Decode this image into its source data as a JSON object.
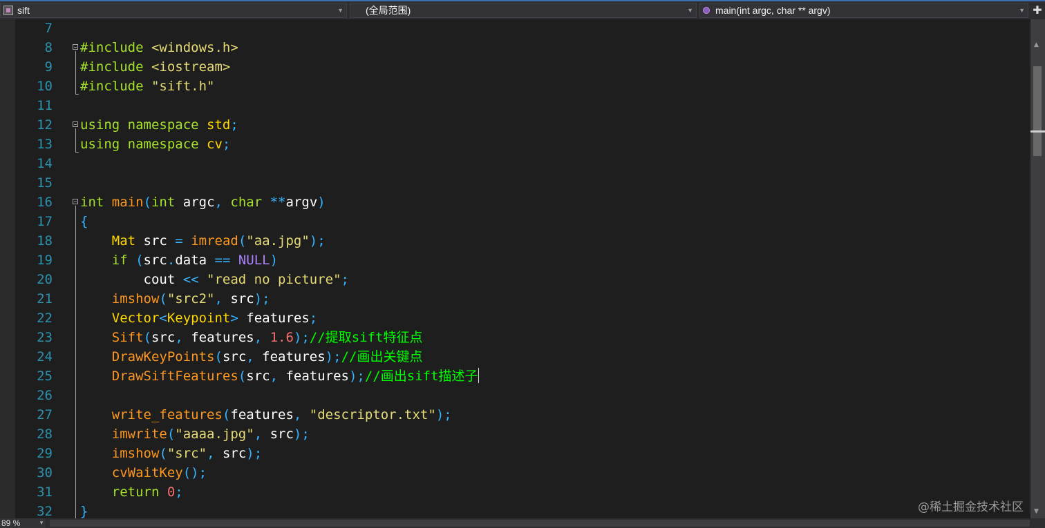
{
  "navbar": {
    "project": "sift",
    "scope": "(全局范围)",
    "member": "main(int argc, char ** argv)",
    "split_icon": "split-plus-icon"
  },
  "editor": {
    "lines": [
      {
        "num": "7",
        "tokens": []
      },
      {
        "num": "8",
        "tokens": [
          [
            "pp",
            "#include "
          ],
          [
            "str",
            "<windows.h>"
          ]
        ]
      },
      {
        "num": "9",
        "tokens": [
          [
            "pp",
            "#include "
          ],
          [
            "str",
            "<iostream>"
          ]
        ]
      },
      {
        "num": "10",
        "tokens": [
          [
            "pp",
            "#include "
          ],
          [
            "str",
            "\"sift.h\""
          ]
        ]
      },
      {
        "num": "11",
        "tokens": []
      },
      {
        "num": "12",
        "tokens": [
          [
            "kw",
            "using namespace "
          ],
          [
            "ns",
            "std"
          ],
          [
            "punc",
            ";"
          ]
        ]
      },
      {
        "num": "13",
        "tokens": [
          [
            "kw",
            "using namespace "
          ],
          [
            "ns",
            "cv"
          ],
          [
            "punc",
            ";"
          ]
        ]
      },
      {
        "num": "14",
        "tokens": []
      },
      {
        "num": "15",
        "tokens": []
      },
      {
        "num": "16",
        "tokens": [
          [
            "kw",
            "int "
          ],
          [
            "fn",
            "main"
          ],
          [
            "punc",
            "("
          ],
          [
            "kw",
            "int "
          ],
          [
            "var",
            "argc"
          ],
          [
            "punc",
            ", "
          ],
          [
            "kw",
            "char "
          ],
          [
            "punc",
            "**"
          ],
          [
            "var",
            "argv"
          ],
          [
            "punc",
            ")"
          ]
        ]
      },
      {
        "num": "17",
        "tokens": [
          [
            "punc",
            "{"
          ]
        ]
      },
      {
        "num": "18",
        "tokens": [
          [
            "plain",
            "    "
          ],
          [
            "type",
            "Mat "
          ],
          [
            "var",
            "src "
          ],
          [
            "punc",
            "= "
          ],
          [
            "fn",
            "imread"
          ],
          [
            "punc",
            "("
          ],
          [
            "str",
            "\"aa.jpg\""
          ],
          [
            "punc",
            ");"
          ]
        ]
      },
      {
        "num": "19",
        "tokens": [
          [
            "plain",
            "    "
          ],
          [
            "kw",
            "if "
          ],
          [
            "punc",
            "("
          ],
          [
            "var",
            "src"
          ],
          [
            "punc",
            "."
          ],
          [
            "var",
            "data "
          ],
          [
            "punc",
            "== "
          ],
          [
            "mac",
            "NULL"
          ],
          [
            "punc",
            ")"
          ]
        ]
      },
      {
        "num": "20",
        "tokens": [
          [
            "plain",
            "        "
          ],
          [
            "var",
            "cout "
          ],
          [
            "punc",
            "<< "
          ],
          [
            "str",
            "\"read no picture\""
          ],
          [
            "punc",
            ";"
          ]
        ]
      },
      {
        "num": "21",
        "tokens": [
          [
            "plain",
            "    "
          ],
          [
            "fn",
            "imshow"
          ],
          [
            "punc",
            "("
          ],
          [
            "str",
            "\"src2\""
          ],
          [
            "punc",
            ", "
          ],
          [
            "var",
            "src"
          ],
          [
            "punc",
            ");"
          ]
        ]
      },
      {
        "num": "22",
        "tokens": [
          [
            "plain",
            "    "
          ],
          [
            "type",
            "Vector"
          ],
          [
            "punc",
            "<"
          ],
          [
            "type",
            "Keypoint"
          ],
          [
            "punc",
            "> "
          ],
          [
            "var",
            "features"
          ],
          [
            "punc",
            ";"
          ]
        ]
      },
      {
        "num": "23",
        "tokens": [
          [
            "plain",
            "    "
          ],
          [
            "fn",
            "Sift"
          ],
          [
            "punc",
            "("
          ],
          [
            "var",
            "src"
          ],
          [
            "punc",
            ", "
          ],
          [
            "var",
            "features"
          ],
          [
            "punc",
            ", "
          ],
          [
            "num",
            "1.6"
          ],
          [
            "punc",
            ");"
          ],
          [
            "cm",
            "//提取sift特征点"
          ]
        ]
      },
      {
        "num": "24",
        "tokens": [
          [
            "plain",
            "    "
          ],
          [
            "fn",
            "DrawKeyPoints"
          ],
          [
            "punc",
            "("
          ],
          [
            "var",
            "src"
          ],
          [
            "punc",
            ", "
          ],
          [
            "var",
            "features"
          ],
          [
            "punc",
            ");"
          ],
          [
            "cm",
            "//画出关键点"
          ]
        ]
      },
      {
        "num": "25",
        "tokens": [
          [
            "plain",
            "    "
          ],
          [
            "fn",
            "DrawSiftFeatures"
          ],
          [
            "punc",
            "("
          ],
          [
            "var",
            "src"
          ],
          [
            "punc",
            ", "
          ],
          [
            "var",
            "features"
          ],
          [
            "punc",
            ");"
          ],
          [
            "cm",
            "//画出sift描述子"
          ]
        ],
        "cursor": true
      },
      {
        "num": "26",
        "tokens": []
      },
      {
        "num": "27",
        "tokens": [
          [
            "plain",
            "    "
          ],
          [
            "fn",
            "write_features"
          ],
          [
            "punc",
            "("
          ],
          [
            "var",
            "features"
          ],
          [
            "punc",
            ", "
          ],
          [
            "str",
            "\"descriptor.txt\""
          ],
          [
            "punc",
            ");"
          ]
        ]
      },
      {
        "num": "28",
        "tokens": [
          [
            "plain",
            "    "
          ],
          [
            "fn",
            "imwrite"
          ],
          [
            "punc",
            "("
          ],
          [
            "str",
            "\"aaaa.jpg\""
          ],
          [
            "punc",
            ", "
          ],
          [
            "var",
            "src"
          ],
          [
            "punc",
            ");"
          ]
        ]
      },
      {
        "num": "29",
        "tokens": [
          [
            "plain",
            "    "
          ],
          [
            "fn",
            "imshow"
          ],
          [
            "punc",
            "("
          ],
          [
            "str",
            "\"src\""
          ],
          [
            "punc",
            ", "
          ],
          [
            "var",
            "src"
          ],
          [
            "punc",
            ");"
          ]
        ]
      },
      {
        "num": "30",
        "tokens": [
          [
            "plain",
            "    "
          ],
          [
            "fn",
            "cvWaitKey"
          ],
          [
            "punc",
            "();"
          ]
        ]
      },
      {
        "num": "31",
        "tokens": [
          [
            "plain",
            "    "
          ],
          [
            "kw",
            "return "
          ],
          [
            "num",
            "0"
          ],
          [
            "punc",
            ";"
          ]
        ]
      },
      {
        "num": "32",
        "tokens": [
          [
            "punc",
            "}"
          ]
        ]
      }
    ]
  },
  "status": {
    "zoom": "89 %"
  },
  "watermark": "@稀土掘金技术社区",
  "colors": {
    "background": "#1e1e1e",
    "line_number": "#2b91af",
    "comment": "#00ff00",
    "string": "#e6db74",
    "function": "#fd971f",
    "type": "#ffd700",
    "keyword": "#a6e22e",
    "punctuation": "#36b3ff",
    "macro": "#ae81ff",
    "number": "#f07070"
  }
}
